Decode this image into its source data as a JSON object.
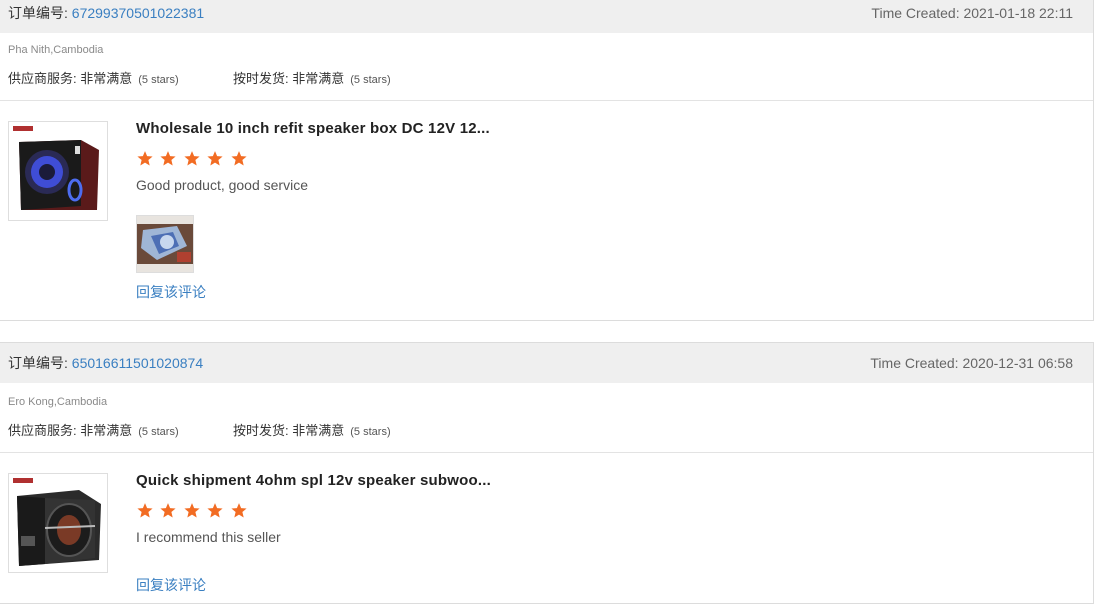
{
  "reviews": [
    {
      "order_label": "订单编号:",
      "order_number": "67299370501022381",
      "time_created": "Time Created: 2021-01-18 22:11",
      "location": "Pha Nith,Cambodia",
      "supplier_service_label": "供应商服务:",
      "supplier_service_value": "非常满意",
      "supplier_service_stars": "(5 stars)",
      "shipping_label": "按时发货:",
      "shipping_value": "非常满意",
      "shipping_stars": "(5 stars)",
      "product_title": "Wholesale 10 inch refit speaker box DC 12V 12...",
      "rating": 5,
      "comment": "Good product, good service",
      "reply_label": "回复该评论"
    },
    {
      "order_label": "订单编号:",
      "order_number": "65016611501020874",
      "time_created": "Time Created: 2020-12-31 06:58",
      "location": "Ero Kong,Cambodia",
      "supplier_service_label": "供应商服务:",
      "supplier_service_value": "非常满意",
      "supplier_service_stars": "(5 stars)",
      "shipping_label": "按时发货:",
      "shipping_value": "非常满意",
      "shipping_stars": "(5 stars)",
      "product_title": "Quick shipment 4ohm spl 12v speaker subwoo...",
      "rating": 5,
      "comment": "I recommend this seller",
      "reply_label": "回复该评论"
    }
  ],
  "colors": {
    "link": "#3a7fc1",
    "star": "#f26c23",
    "header_bg": "#efefef"
  }
}
